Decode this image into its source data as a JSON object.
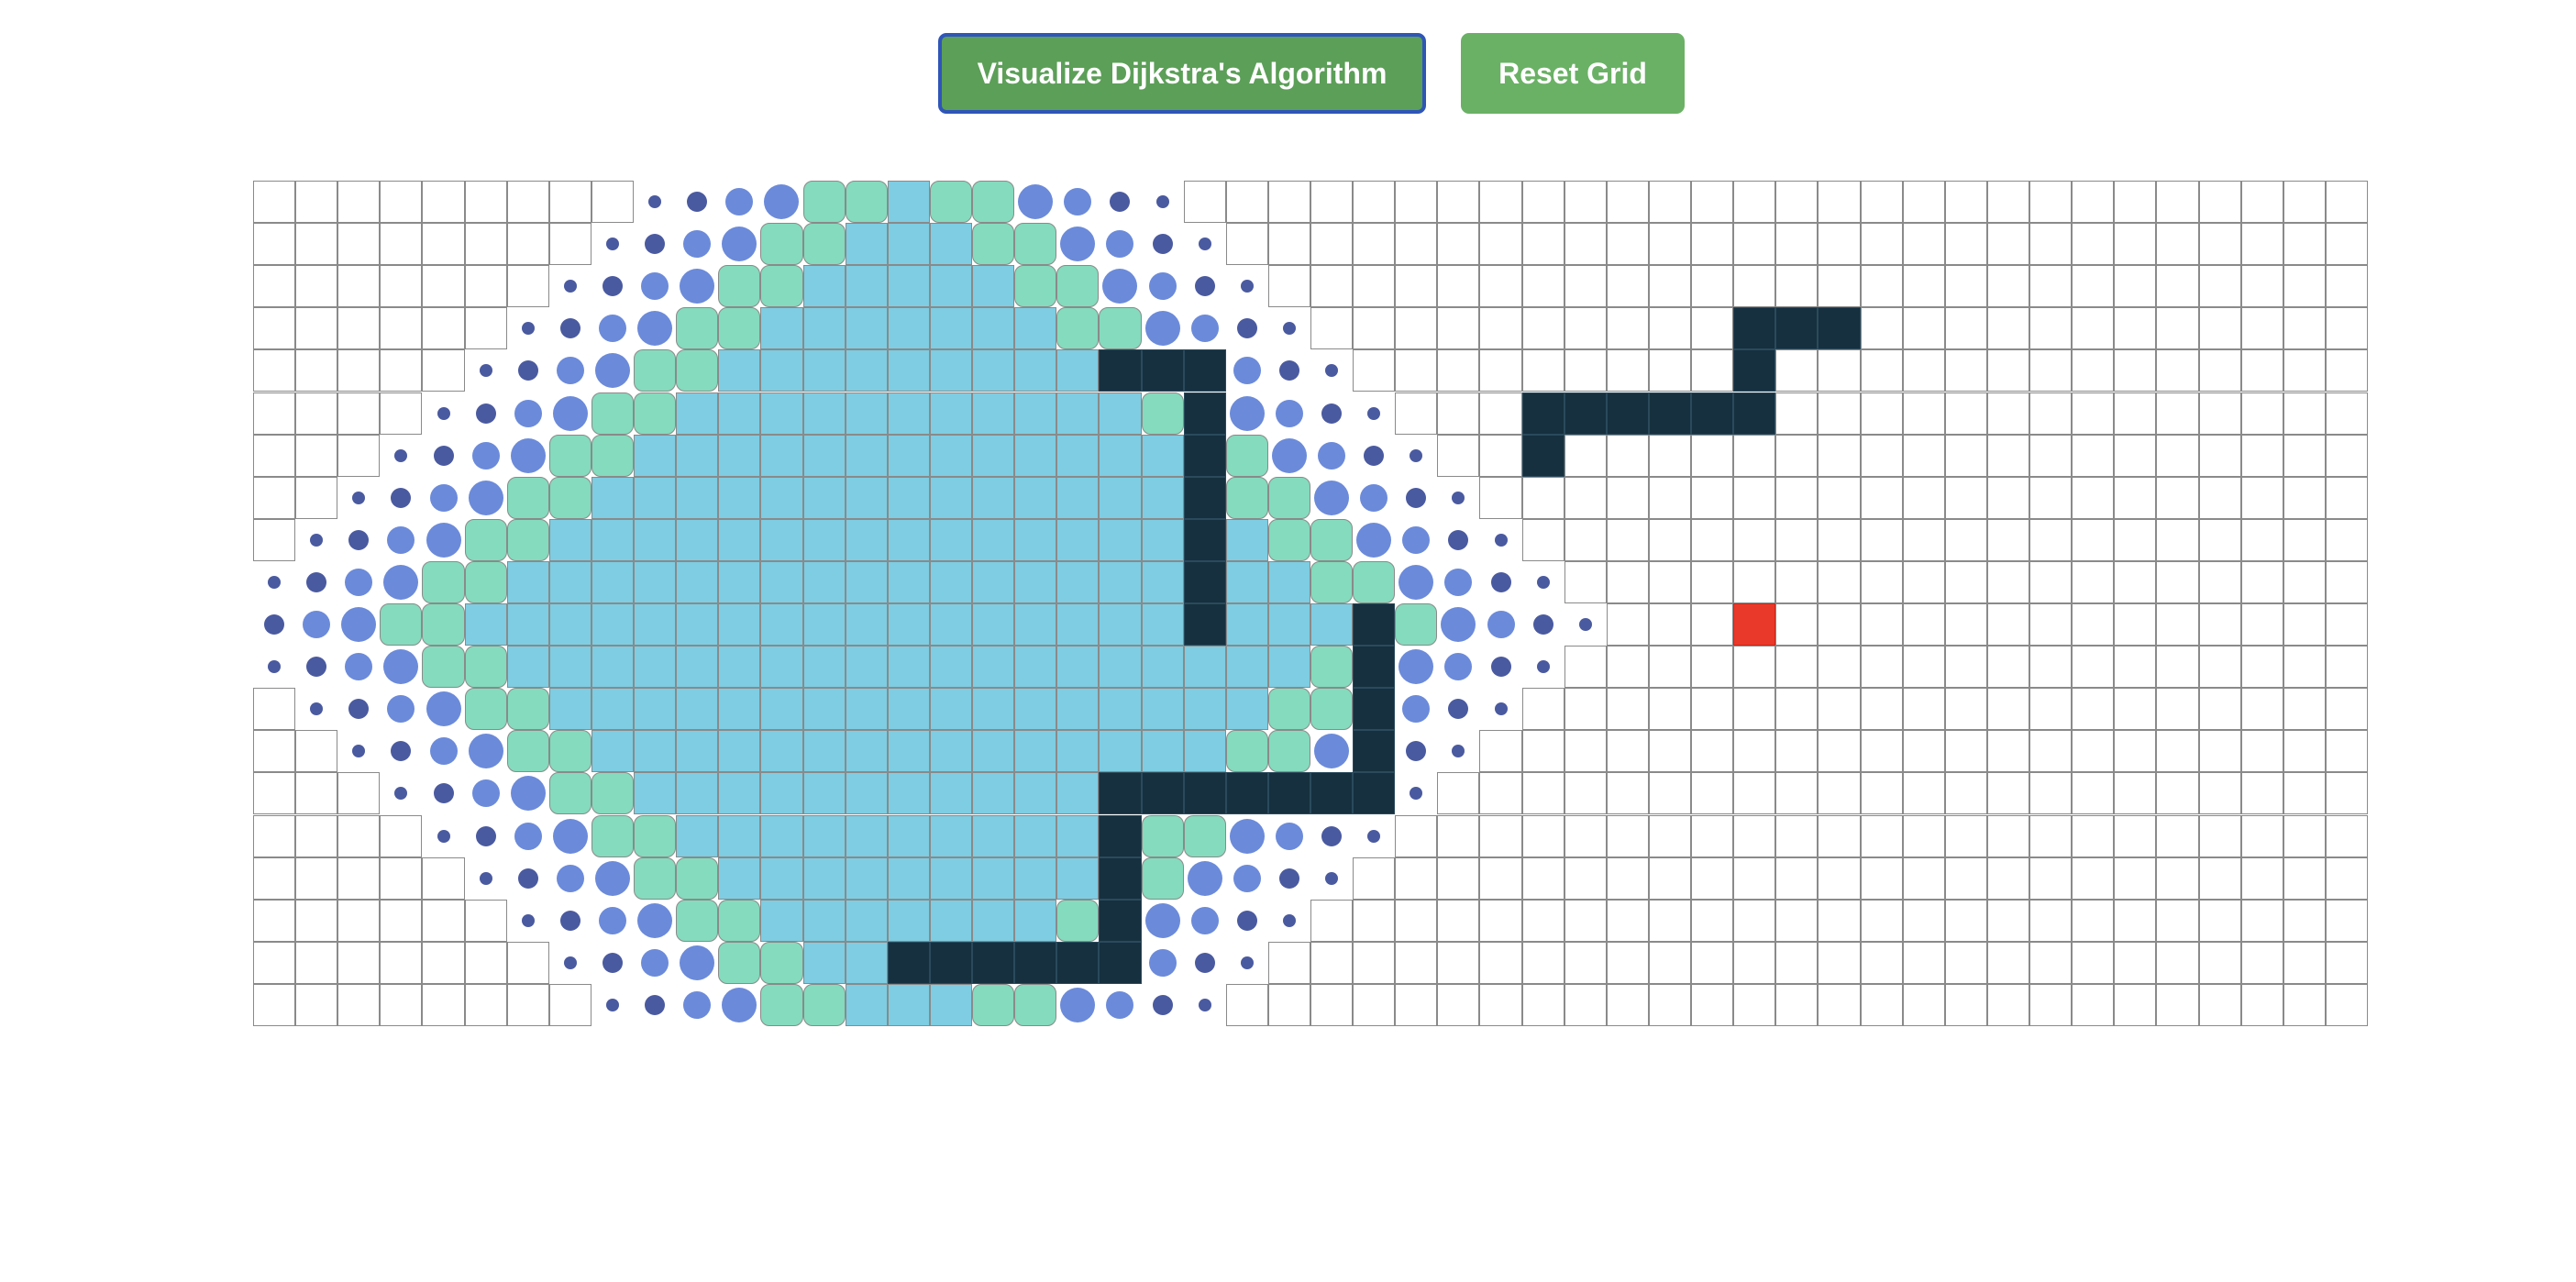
{
  "toolbar": {
    "visualize_label": "Visualize Dijkstra's Algorithm",
    "reset_label": "Reset Grid"
  },
  "grid": {
    "rows": 20,
    "cols": 50,
    "target": [
      10,
      35
    ],
    "walls": [
      [
        3,
        35
      ],
      [
        3,
        36
      ],
      [
        3,
        37
      ],
      [
        4,
        20
      ],
      [
        4,
        21
      ],
      [
        4,
        22
      ],
      [
        4,
        35
      ],
      [
        5,
        22
      ],
      [
        5,
        30
      ],
      [
        5,
        31
      ],
      [
        5,
        32
      ],
      [
        5,
        33
      ],
      [
        5,
        34
      ],
      [
        5,
        35
      ],
      [
        6,
        22
      ],
      [
        6,
        30
      ],
      [
        7,
        22
      ],
      [
        8,
        22
      ],
      [
        9,
        22
      ],
      [
        10,
        22
      ],
      [
        10,
        26
      ],
      [
        11,
        26
      ],
      [
        12,
        26
      ],
      [
        13,
        26
      ],
      [
        14,
        20
      ],
      [
        14,
        21
      ],
      [
        14,
        22
      ],
      [
        14,
        23
      ],
      [
        14,
        24
      ],
      [
        14,
        25
      ],
      [
        14,
        26
      ],
      [
        15,
        20
      ],
      [
        16,
        20
      ],
      [
        17,
        20
      ],
      [
        18,
        15
      ],
      [
        18,
        16
      ],
      [
        18,
        17
      ],
      [
        18,
        18
      ],
      [
        18,
        19
      ],
      [
        18,
        20
      ]
    ],
    "colors": {
      "wall": "#16303f",
      "target": "#e8392a",
      "visited": "#7ecde2",
      "frontier_mint": "#84dbbd",
      "frontier_steel": "#71a8d6",
      "wave_dot": "#6b8ada",
      "wave_dot_far": "#4a5aa0",
      "button": "#6ab165",
      "button_focus_border": "#2f55b8"
    }
  }
}
